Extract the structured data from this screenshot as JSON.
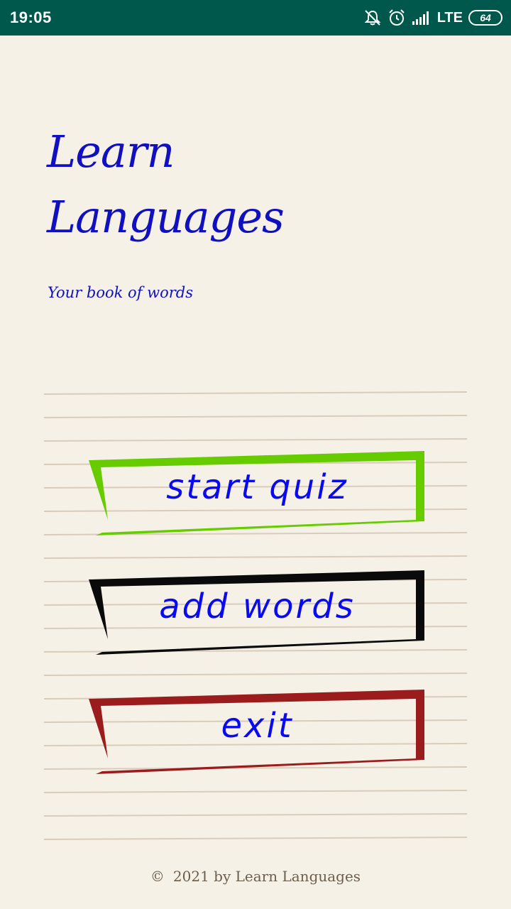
{
  "status_bar": {
    "time": "19:05",
    "network": "LTE",
    "battery": "64",
    "icons": [
      "mute-icon",
      "alarm-icon",
      "signal-icon"
    ]
  },
  "title": {
    "line1": "Learn",
    "line2": "Languages"
  },
  "subtitle": "Your book of words",
  "menu": {
    "start_quiz": "start quiz",
    "add_words": "add words",
    "exit": "exit"
  },
  "colors": {
    "background": "#f6f1e6",
    "status_bar": "#00574b",
    "title_text": "#1010c0",
    "button_text": "#0a0af0",
    "start_quiz_frame": "#66cc00",
    "add_words_frame": "#0a0a0a",
    "exit_frame": "#9b1c1c",
    "notebook_lines": "#d9ccbc"
  },
  "footer": {
    "copyright_symbol": "©",
    "text": "2021 by Learn Languages"
  }
}
